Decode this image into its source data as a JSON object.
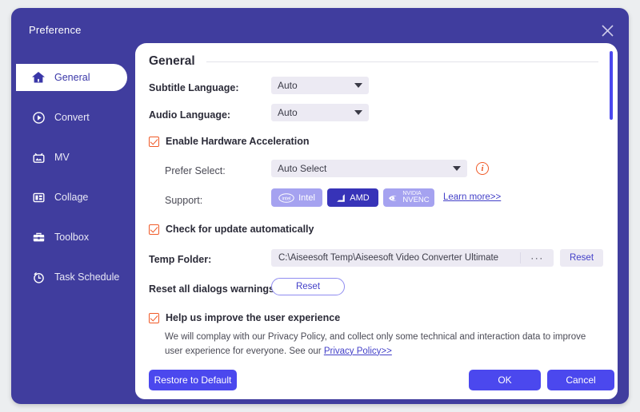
{
  "window": {
    "title": "Preference",
    "close_icon": "close-icon"
  },
  "sidebar": {
    "items": [
      {
        "label": "General",
        "icon": "home-icon",
        "active": true
      },
      {
        "label": "Convert",
        "icon": "play-circle-icon",
        "active": false
      },
      {
        "label": "MV",
        "icon": "video-icon",
        "active": false
      },
      {
        "label": "Collage",
        "icon": "layout-icon",
        "active": false
      },
      {
        "label": "Toolbox",
        "icon": "briefcase-icon",
        "active": false
      },
      {
        "label": "Task Schedule",
        "icon": "alarm-clock-icon",
        "active": false
      }
    ]
  },
  "section": {
    "title": "General"
  },
  "subtitle_language": {
    "label": "Subtitle Language:",
    "value": "Auto"
  },
  "audio_language": {
    "label": "Audio Language:",
    "value": "Auto"
  },
  "hardware_acceleration": {
    "label": "Enable Hardware Acceleration",
    "checked": true
  },
  "prefer_select": {
    "label": "Prefer Select:",
    "value": "Auto Select",
    "info_icon": "info-icon",
    "info_glyph": "i"
  },
  "support": {
    "label": "Support:",
    "badges": [
      {
        "name": "Intel",
        "state": "inactive"
      },
      {
        "name": "AMD",
        "state": "active"
      },
      {
        "name": "NVIDIA NVENC",
        "state": "inactive",
        "line1": "NVIDIA",
        "line2": "NVENC"
      }
    ],
    "learn_more": "Learn more>>"
  },
  "check_update": {
    "label": "Check for update automatically",
    "checked": true
  },
  "temp_folder": {
    "label": "Temp Folder:",
    "value": "C:\\Aiseesoft Temp\\Aiseesoft Video Converter Ultimate",
    "browse_label": "···",
    "reset_label": "Reset"
  },
  "reset_dialogs": {
    "label": "Reset all dialogs warnings:",
    "button_label": "Reset"
  },
  "improve_experience": {
    "label": "Help us improve the user experience",
    "checked": true,
    "paragraph_before": "We will complay with our Privacy Policy, and collect only some technical and interaction data to improve user experience for everyone. See our ",
    "link_label": "Privacy Policy>>"
  },
  "footer": {
    "restore_label": "Restore to Default",
    "ok_label": "OK",
    "cancel_label": "Cancel"
  },
  "colors": {
    "window_purple": "#403d9e",
    "accent_blue": "#4b48ee",
    "accent_orange": "#f05a28",
    "badge_active": "#3733b8",
    "badge_inactive": "#a5a2f0",
    "field_bg": "#eceaf3",
    "page_bg": "#eceef0"
  }
}
